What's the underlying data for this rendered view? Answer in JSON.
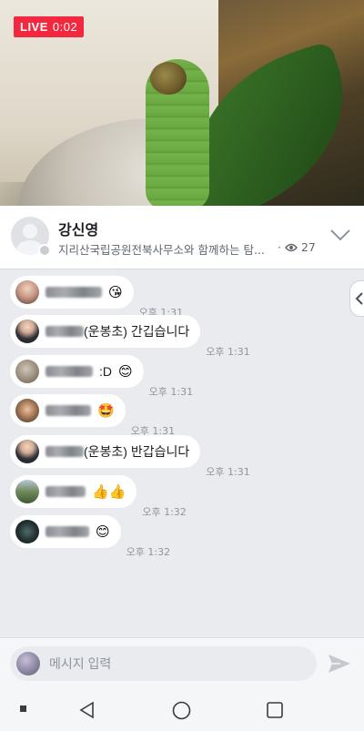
{
  "live": {
    "label": "LIVE",
    "time": "0:02"
  },
  "profile": {
    "name": "강신영",
    "subtitle": "지리산국립공원전북사무소와 함께하는 탐...",
    "view_count": "27"
  },
  "messages": [
    {
      "author": "",
      "text": "",
      "emoji": "😘",
      "time": "오후 1:31"
    },
    {
      "author": "",
      "text": "(운봉초) 간깁습니다",
      "emoji": "",
      "time": "오후 1:31"
    },
    {
      "author": "",
      "text": ":D",
      "emoji": "😊",
      "time": "오후 1:31"
    },
    {
      "author": "",
      "text": "",
      "emoji": "🤩",
      "time": "오후 1:31"
    },
    {
      "author": "",
      "text": "(운봉초) 반갑습니다",
      "emoji": "",
      "time": "오후 1:31"
    },
    {
      "author": "",
      "text": "",
      "emoji": "👍👍",
      "time": "오후 1:32"
    },
    {
      "author": "",
      "text": "",
      "emoji": "😊",
      "time": "오후 1:32"
    }
  ],
  "composer": {
    "placeholder": "메시지 입력"
  },
  "icons": {
    "expand": "chevron-down-icon",
    "views": "eye-icon",
    "send": "send-icon",
    "panel": "chevron-left-icon",
    "nav": [
      "square-dot-icon",
      "back-icon",
      "home-icon",
      "recents-icon"
    ]
  },
  "colors": {
    "live": "#f3273d",
    "chat_bg": "#e9ebee",
    "bubble": "#ffffff"
  }
}
